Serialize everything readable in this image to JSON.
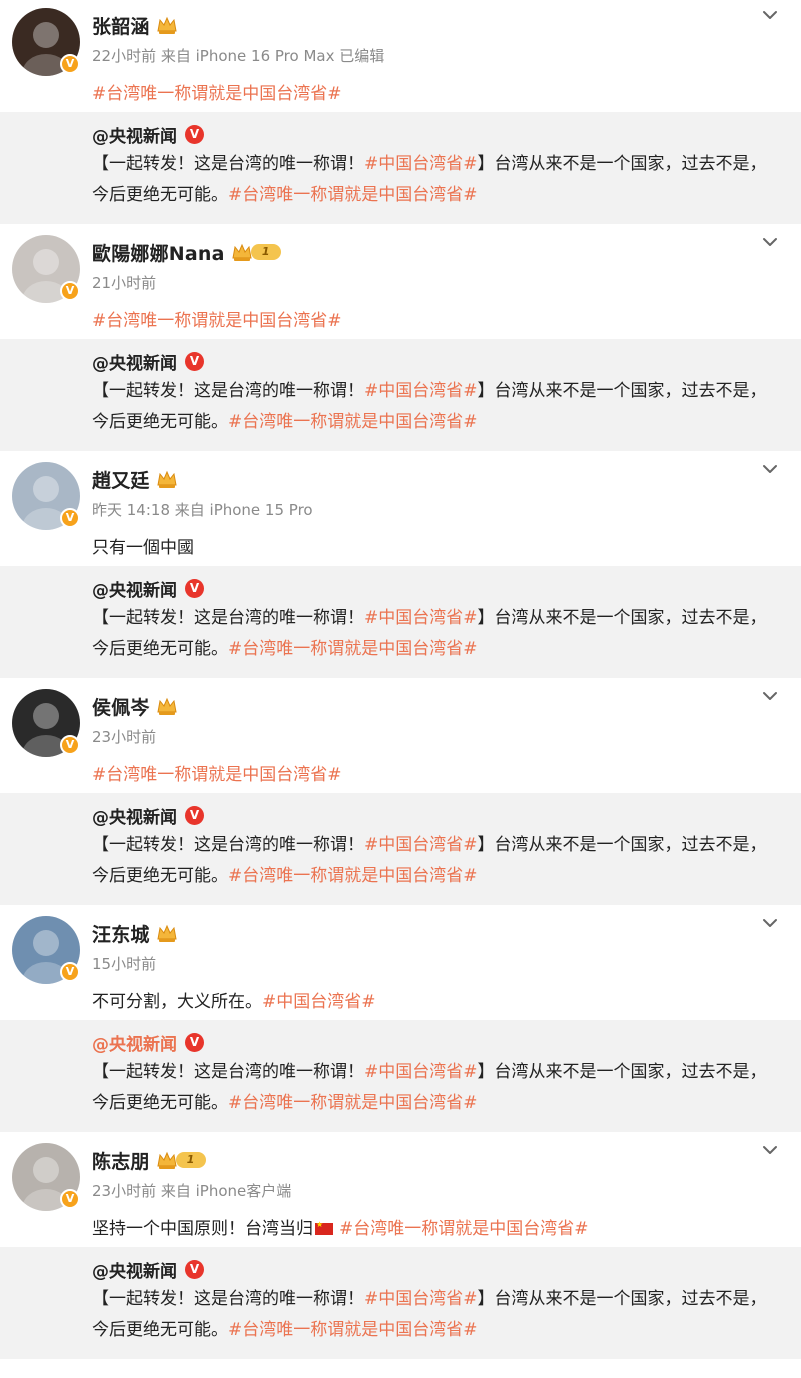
{
  "repost": {
    "author": "@央视新闻",
    "verified_mark": "V",
    "segments": [
      {
        "text": "【一起转发！这是台湾的唯一称谓！",
        "tag": false
      },
      {
        "text": "#中国台湾省#",
        "tag": true
      },
      {
        "text": "】台湾从来不是一个国家，过去不是，今后更绝无可能。",
        "tag": false
      },
      {
        "text": "#台湾唯一称谓就是中国台湾省#",
        "tag": true
      }
    ]
  },
  "posts": [
    {
      "name": "张韶涵",
      "badge": "crown",
      "meta": "22小时前  来自 iPhone 16 Pro Max 已编辑",
      "body": [
        {
          "text": "#台湾唯一称谓就是中国台湾省#",
          "tag": true
        }
      ],
      "avatar_color": "#3a2a22",
      "repost_author_orange": false
    },
    {
      "name": "歐陽娜娜Nana",
      "badge": "crown-level",
      "level": "1",
      "meta": "21小时前",
      "body": [
        {
          "text": "#台湾唯一称谓就是中国台湾省#",
          "tag": true
        }
      ],
      "avatar_color": "#c9c4c0",
      "repost_author_orange": false
    },
    {
      "name": "趙又廷",
      "badge": "crown",
      "meta": "昨天 14:18  来自 iPhone 15 Pro",
      "body": [
        {
          "text": "只有一個中國",
          "tag": false
        }
      ],
      "avatar_color": "#a9b7c6",
      "repost_author_orange": false
    },
    {
      "name": "侯佩岑",
      "badge": "crown",
      "meta": "23小时前",
      "body": [
        {
          "text": "#台湾唯一称谓就是中国台湾省#",
          "tag": true
        }
      ],
      "avatar_color": "#2a2a2a",
      "repost_author_orange": false
    },
    {
      "name": "汪东城",
      "badge": "crown",
      "meta": "15小时前",
      "body": [
        {
          "text": "不可分割，大义所在。",
          "tag": false
        },
        {
          "text": "#中国台湾省#",
          "tag": true
        }
      ],
      "avatar_color": "#6f8fb0",
      "repost_author_orange": true
    },
    {
      "name": "陈志朋",
      "badge": "crown-level",
      "level": "1",
      "meta": "23小时前  来自 iPhone客户端",
      "body": [
        {
          "text": "坚持一个中国原则！台湾当归",
          "tag": false
        },
        {
          "text": "",
          "flag": true
        },
        {
          "text": "#台湾唯一称谓就是中国台湾省#",
          "tag": true
        }
      ],
      "avatar_color": "#b7b2ad",
      "repost_author_orange": false
    }
  ],
  "colors": {
    "tag": "#eb7350",
    "meta": "#8a8a8a",
    "repost_bg": "#f2f2f2",
    "verified_orange": "#f7a21b",
    "verified_red": "#e8352b"
  },
  "icons": {
    "expand": "chevron-down-icon",
    "member": "crown-icon",
    "verified": "verified-v-icon"
  }
}
